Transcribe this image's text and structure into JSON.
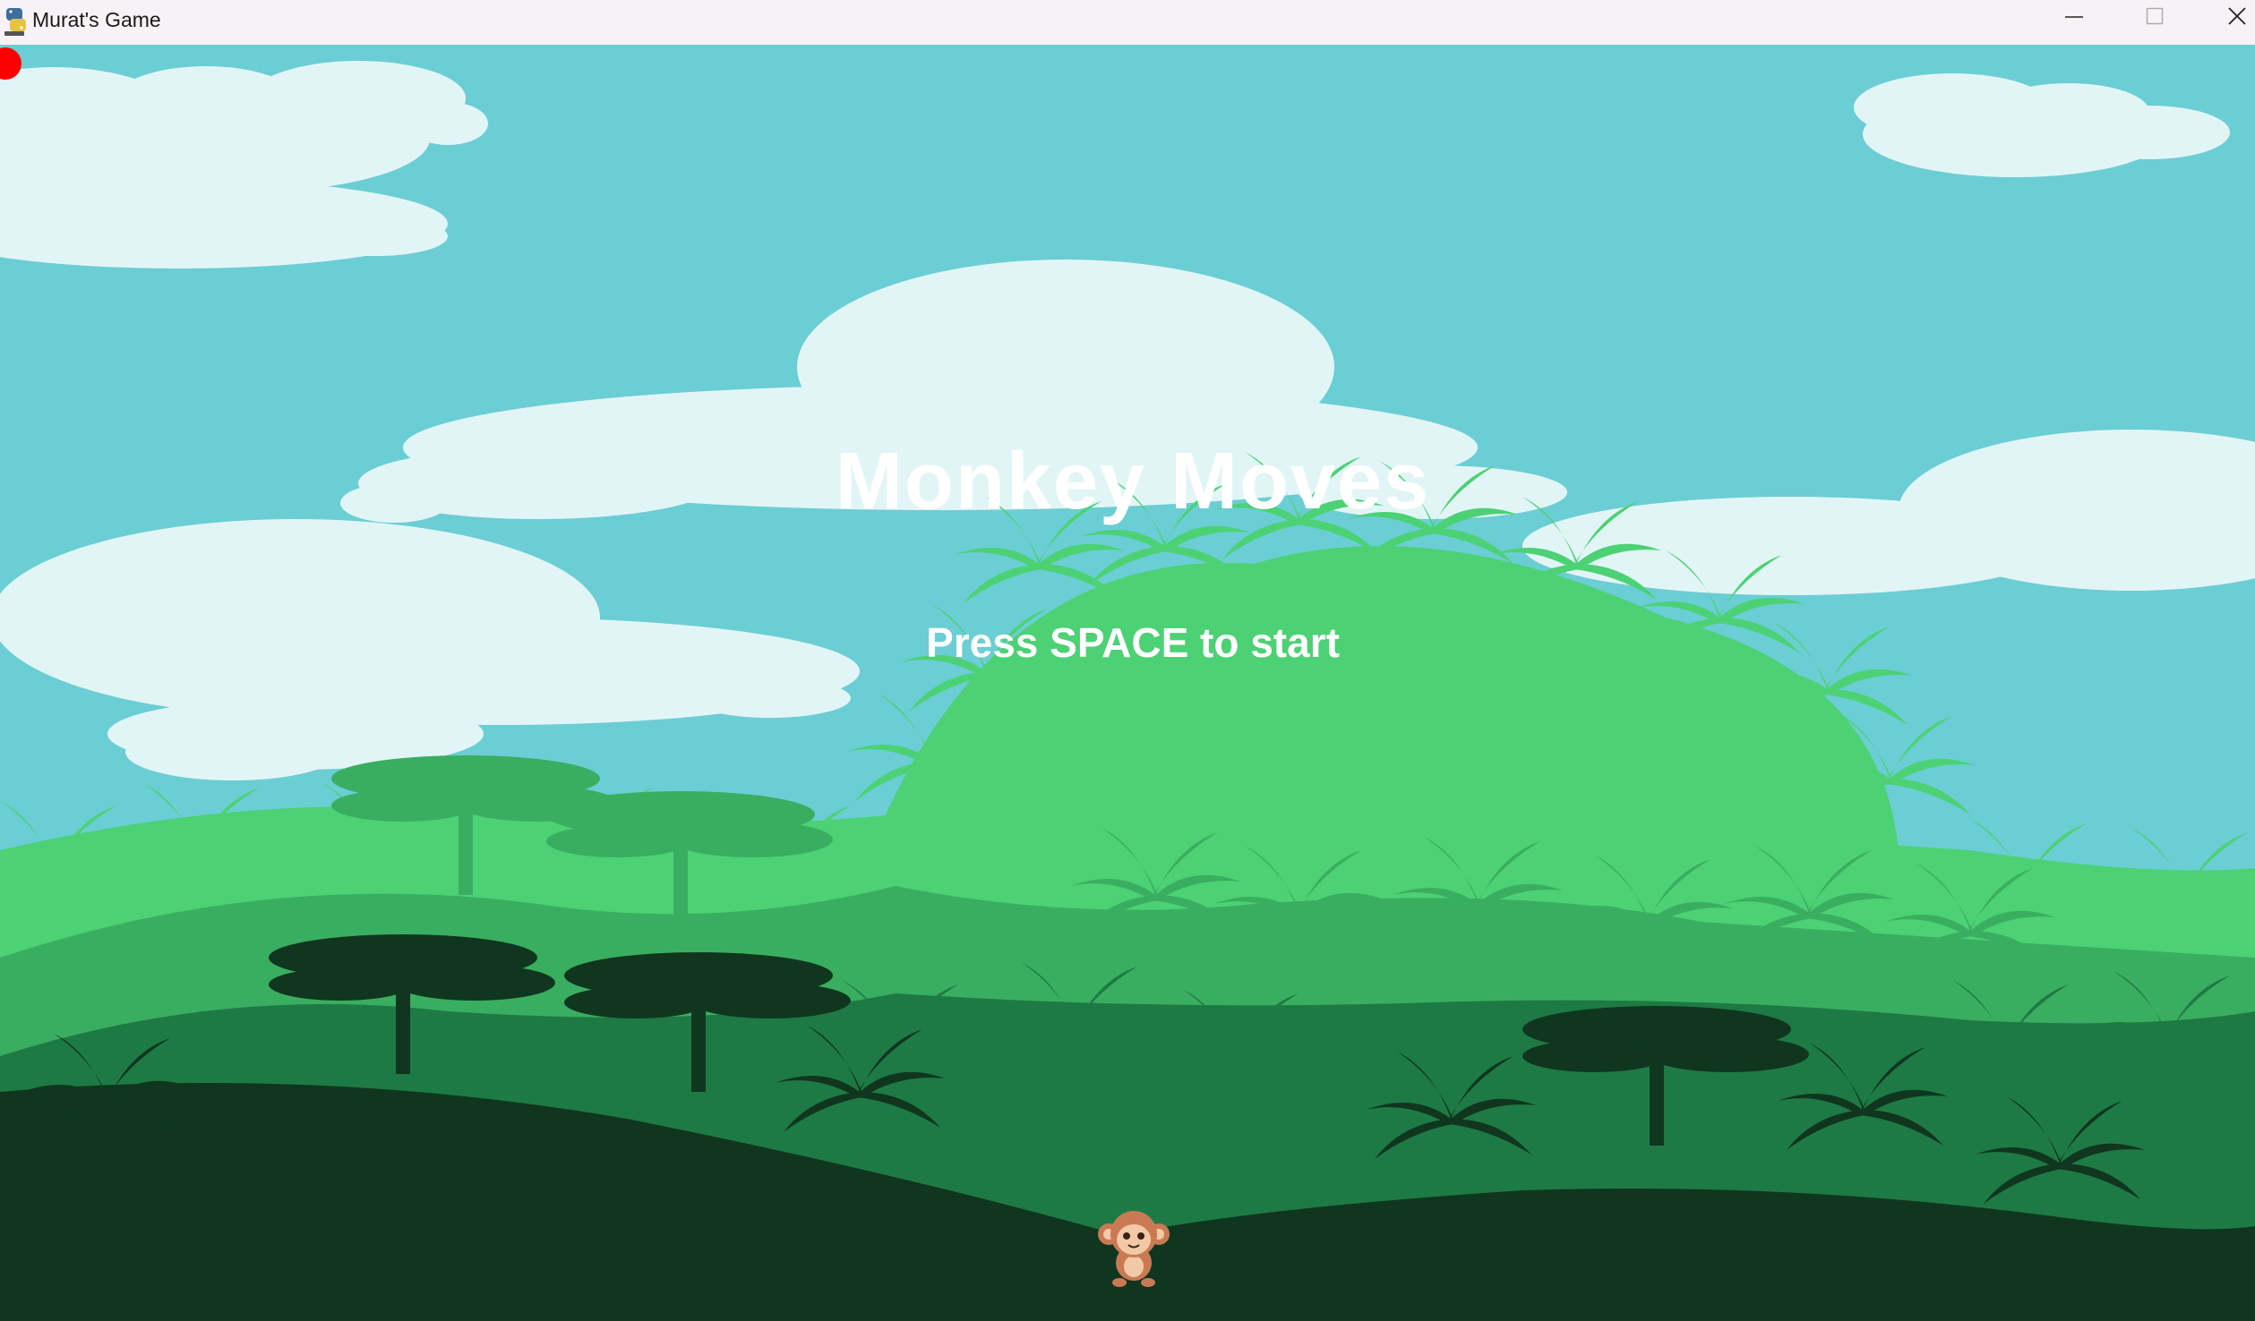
{
  "window": {
    "title": "Murat's Game",
    "app_icon": "python-icon",
    "controls": [
      "minimize-icon",
      "maximize-icon",
      "close-icon"
    ]
  },
  "game": {
    "title": "Monkey Moves",
    "prompt": "Press SPACE to start",
    "scene": "jungle-background",
    "player_sprite": "monkey-icon",
    "marker": "red-dot"
  },
  "colors": {
    "titlebar_bg": "#f6f2f5",
    "sky": "#6bced4",
    "cloud": "#e2f5f6",
    "jungle_light": "#4cd174",
    "jungle_mid": "#3aae60",
    "jungle_dark": "#1e7a45",
    "jungle_darkest": "#10361f",
    "text": "#ffffff",
    "marker": "#ff0000",
    "monkey": "#c97a55"
  }
}
